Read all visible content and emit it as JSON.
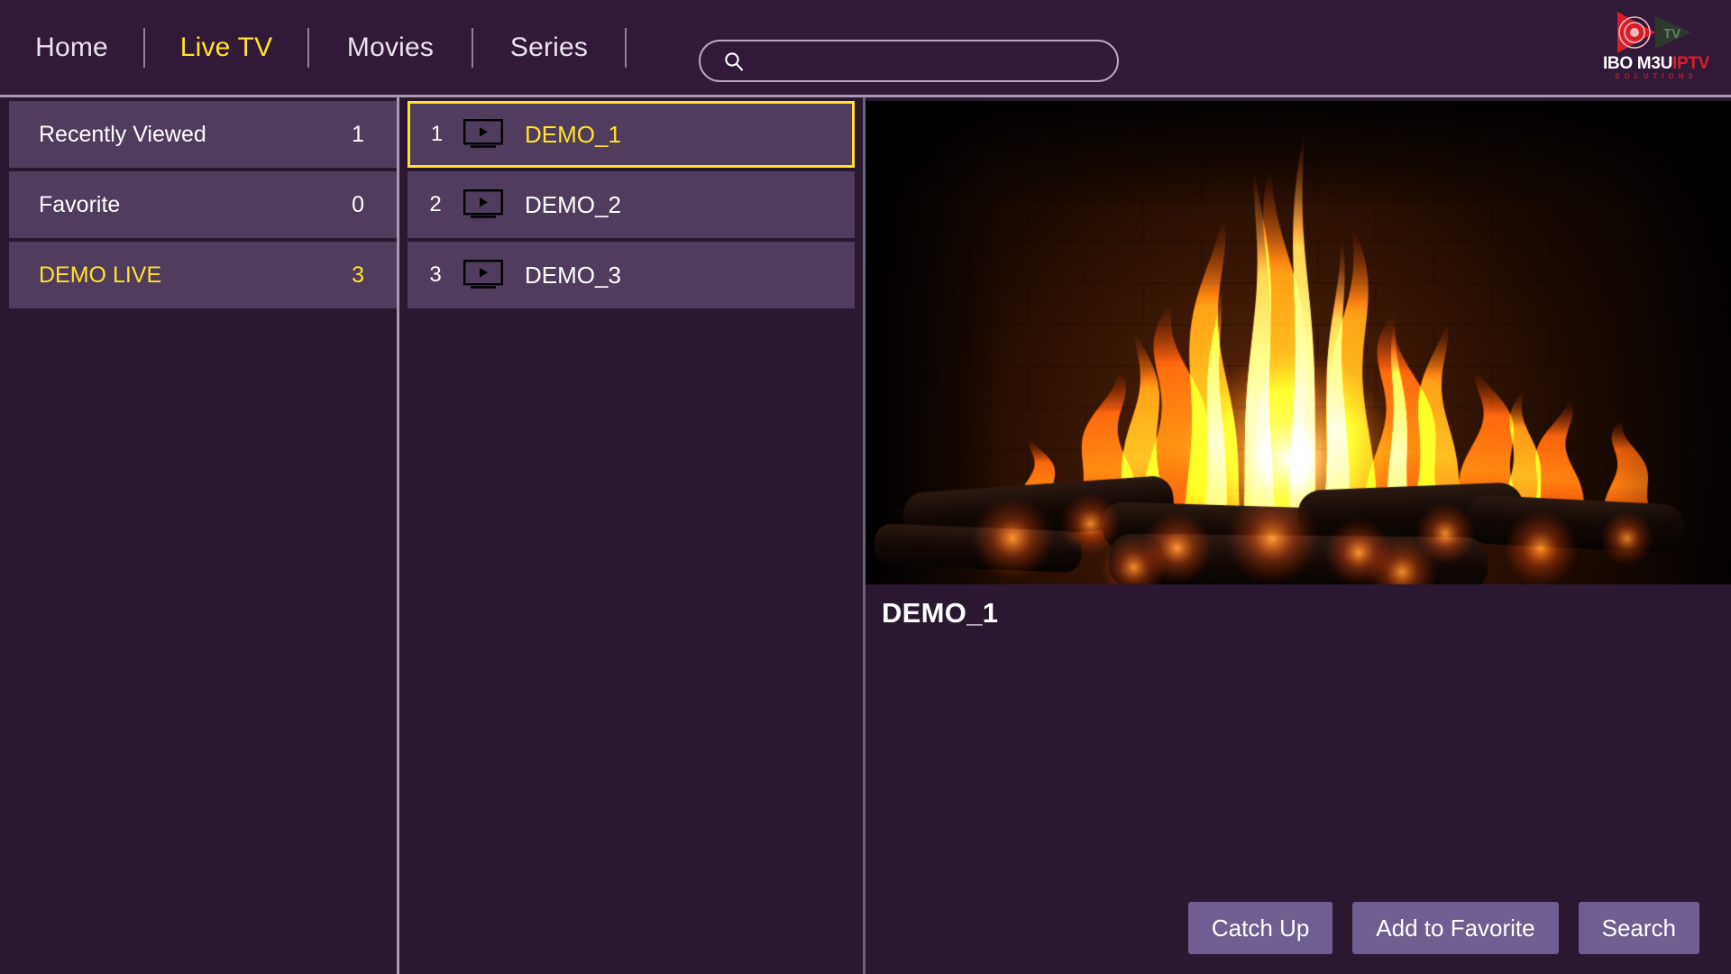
{
  "header": {
    "nav_items": [
      {
        "label": "Home",
        "active": false
      },
      {
        "label": "Live TV",
        "active": true
      },
      {
        "label": "Movies",
        "active": false
      },
      {
        "label": "Series",
        "active": false
      }
    ],
    "search": {
      "value": "",
      "placeholder": "",
      "icon": "search-icon"
    },
    "logo": {
      "text_white": "IBO M3U",
      "text_red": "IPTV",
      "subtitle": "SOLUTIONS",
      "icon": "play-triangle-logo-icon"
    }
  },
  "categories": [
    {
      "label": "Recently Viewed",
      "count": "1",
      "selected": false
    },
    {
      "label": "Favorite",
      "count": "0",
      "selected": false
    },
    {
      "label": "DEMO LIVE",
      "count": "3",
      "selected": true
    }
  ],
  "channels": [
    {
      "number": "1",
      "name": "DEMO_1",
      "icon": "tv-play-icon",
      "selected": true
    },
    {
      "number": "2",
      "name": "DEMO_2",
      "icon": "tv-play-icon",
      "selected": false
    },
    {
      "number": "3",
      "name": "DEMO_3",
      "icon": "tv-play-icon",
      "selected": false
    }
  ],
  "preview": {
    "now_playing_title": "DEMO_1",
    "content_description": "fireplace-with-burning-logs"
  },
  "actions": [
    {
      "label": "Catch Up"
    },
    {
      "label": "Add to Favorite"
    },
    {
      "label": "Search"
    }
  ],
  "colors": {
    "app_background": "#2a1730",
    "header_background": "#311a38",
    "row_background": "#503c5c",
    "accent_yellow": "#ffe22e",
    "button_purple": "#6f5e92",
    "divider_light": "#a79ab0",
    "text_primary": "#ffffff",
    "logo_red": "#e01b28"
  }
}
